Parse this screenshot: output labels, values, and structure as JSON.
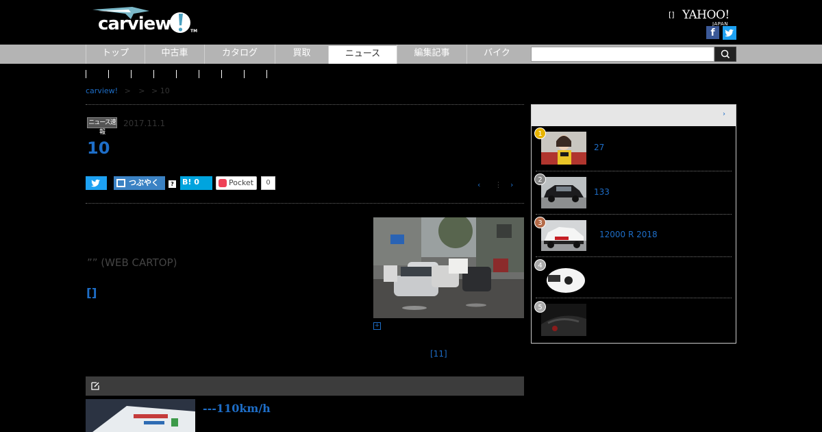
{
  "header": {
    "logo_text": "carview",
    "logo_tm": "TM",
    "help_link": "[]",
    "yahoo_logo": "YAHOO!",
    "yahoo_sub": "JAPAN",
    "facebook_glyph": "f"
  },
  "nav": {
    "items": [
      {
        "label": "トップ"
      },
      {
        "label": "中古車"
      },
      {
        "label": "カタログ"
      },
      {
        "label": "買取"
      },
      {
        "label": "ニュース",
        "active": true
      },
      {
        "label": "編集記事"
      },
      {
        "label": "バイク"
      }
    ],
    "search_placeholder": ""
  },
  "breadcrumb": {
    "home": "carview!",
    "sep1": ">",
    "sep2": ">",
    "current": "> 10"
  },
  "article": {
    "category": "ニュース速報",
    "date": "2017.11.1",
    "title": "10",
    "lead": "”” (WEB CARTOP)",
    "related_link": "[]",
    "photo_count": "[11]",
    "enlarge_glyph": "+",
    "pager_prev": "‹",
    "pager_sep": "⋮",
    "pager_next": "›"
  },
  "share": {
    "tsubuyaku": "つぶやく",
    "q": "?",
    "hatena": "B! 0",
    "pocket": "Pocket",
    "pocket_count": "0"
  },
  "next_article": {
    "title": "---110km/h"
  },
  "ranking": {
    "more": "›",
    "items": [
      {
        "rank": "1",
        "title": "27",
        "badge_color": "#e8b400"
      },
      {
        "rank": "2",
        "title": "133",
        "badge_color": "#888888"
      },
      {
        "rank": "3",
        "title": "12000 R 2018",
        "badge_color": "#b46a48"
      },
      {
        "rank": "4",
        "title": "",
        "badge_color": "#aaaaaa"
      },
      {
        "rank": "5",
        "title": "",
        "badge_color": "#aaaaaa"
      }
    ]
  },
  "colors": {
    "link": "#1e6ec8",
    "nav_bg": "#b4b4b4",
    "background": "#000000"
  }
}
